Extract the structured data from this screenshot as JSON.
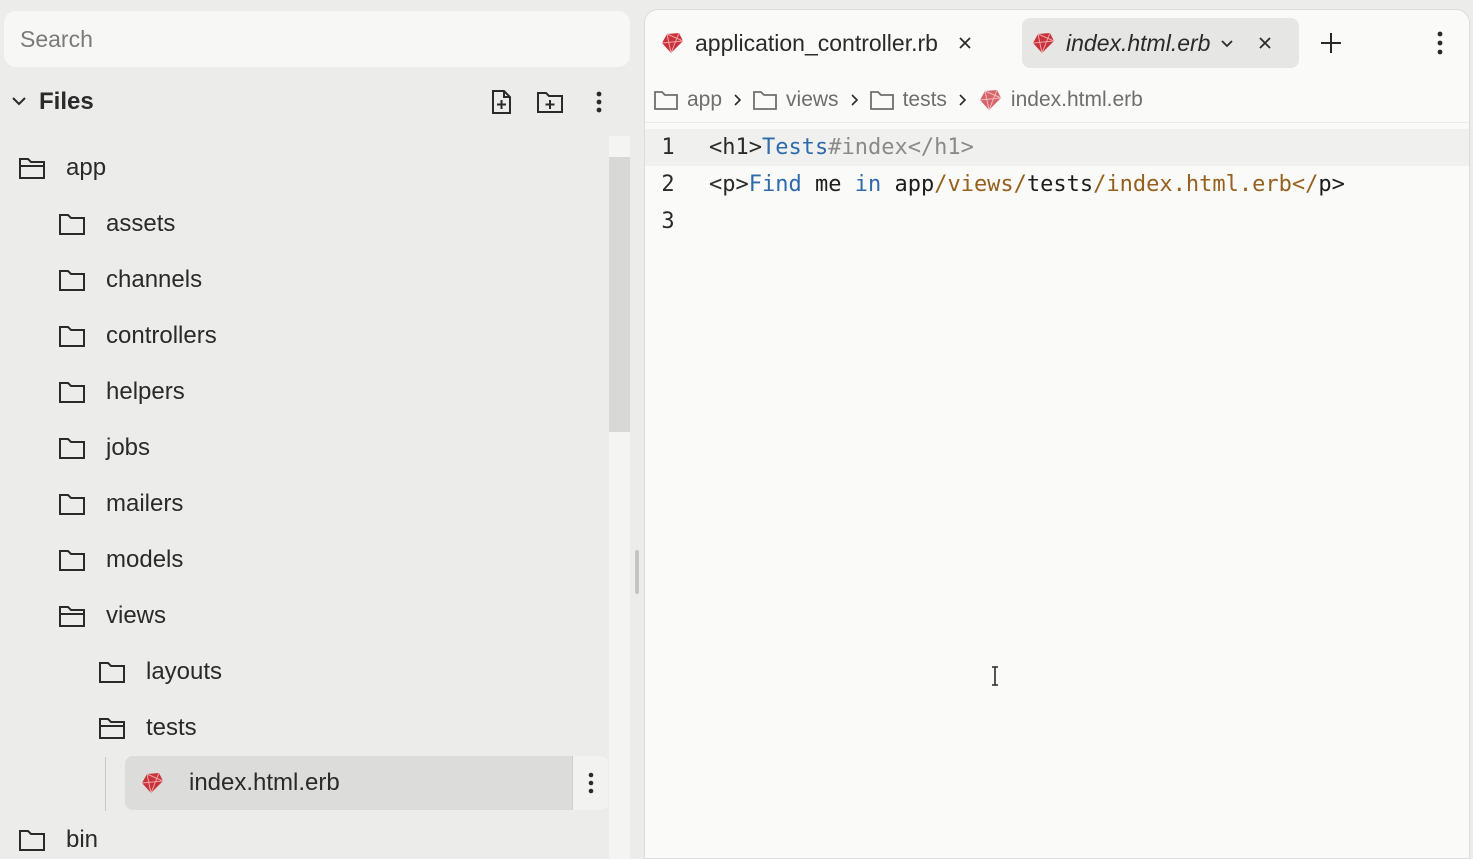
{
  "search": {
    "placeholder": "Search"
  },
  "files_panel": {
    "title": "Files"
  },
  "tree": [
    {
      "label": "app",
      "kind": "folder-open"
    },
    {
      "label": "assets",
      "kind": "folder"
    },
    {
      "label": "channels",
      "kind": "folder"
    },
    {
      "label": "controllers",
      "kind": "folder"
    },
    {
      "label": "helpers",
      "kind": "folder"
    },
    {
      "label": "jobs",
      "kind": "folder"
    },
    {
      "label": "mailers",
      "kind": "folder"
    },
    {
      "label": "models",
      "kind": "folder"
    },
    {
      "label": "views",
      "kind": "folder-open"
    },
    {
      "label": "layouts",
      "kind": "folder"
    },
    {
      "label": "tests",
      "kind": "folder-open"
    },
    {
      "label": "index.html.erb",
      "kind": "ruby-file"
    },
    {
      "label": "bin",
      "kind": "folder"
    }
  ],
  "tabs": [
    {
      "label": "application_controller.rb",
      "icon": "ruby-icon"
    },
    {
      "label": "index.html.erb",
      "icon": "ruby-icon"
    }
  ],
  "breadcrumb": [
    "app",
    "views",
    "tests",
    "index.html.erb"
  ],
  "code": {
    "line_numbers": [
      "1",
      "2",
      "3"
    ],
    "line1": {
      "open_tag": "<h1>",
      "text1": "Tests",
      "text2": "#index</h1>"
    },
    "line2": {
      "open_tag": "<p>",
      "find": "Find",
      "sp1": " me ",
      "in_kw": "in",
      "sp2": " app",
      "slash1": "/views/",
      "tests": "tests",
      "slash2": "/index.html.erb</",
      "close": "p>"
    }
  },
  "colors": {
    "ruby": "#c8323a",
    "accent_blue": "#2f6bab",
    "string_brown": "#96601e"
  }
}
